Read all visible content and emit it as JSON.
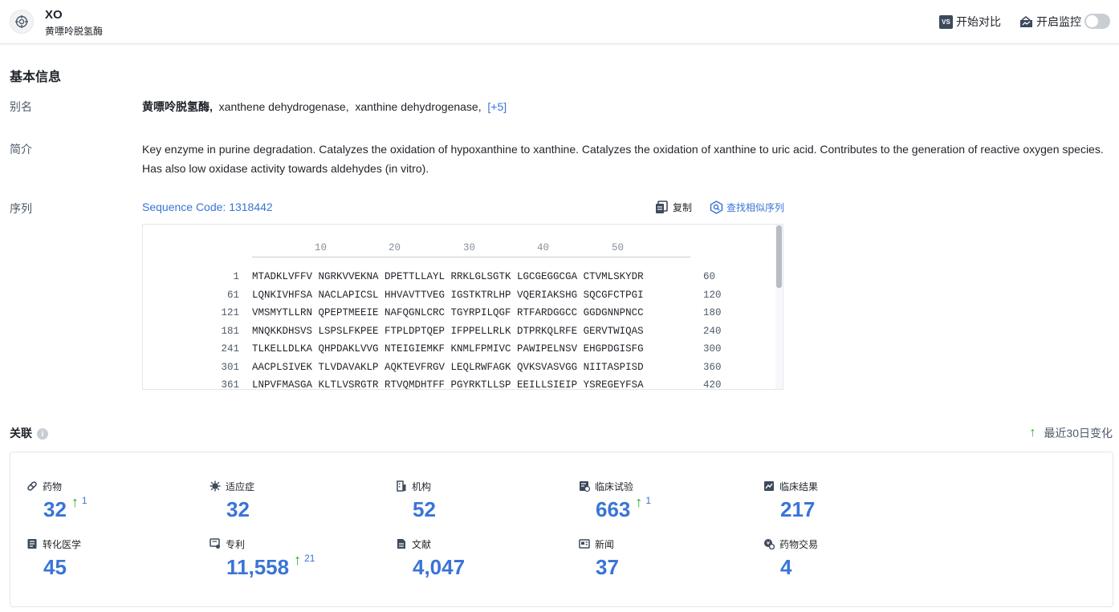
{
  "header": {
    "title": "XO",
    "subtitle": "黄嘌呤脱氢酶",
    "compare_label": "开始对比",
    "compare_badge": "VS",
    "monitor_label": "开启监控",
    "monitor_enabled": false
  },
  "basic_info": {
    "section_title": "基本信息",
    "alias_label": "别名",
    "aliases": [
      "黄嘌呤脱氢酶,",
      "xanthene dehydrogenase,",
      "xanthine dehydrogenase,"
    ],
    "alias_more": "[+5]",
    "intro_label": "简介",
    "intro_text": "Key enzyme in purine degradation. Catalyzes the oxidation of hypoxanthine to xanthine. Catalyzes the oxidation of xanthine to uric acid. Contributes to the generation of reactive oxygen species. Has also low oxidase activity towards aldehydes (in vitro).",
    "sequence_label": "序列",
    "sequence_code": "Sequence Code: 1318442",
    "copy_label": "复制",
    "find_similar_label": "查找相似序列",
    "ruler_ticks": [
      "10",
      "20",
      "30",
      "40",
      "50"
    ],
    "sequence_rows": [
      {
        "start": "1",
        "seq": "MTADKLVFFV NGRKVVEKNA DPETTLLAYL RRKLGLSGTK LGCGEGGCGA CTVMLSKYDR",
        "end": "60"
      },
      {
        "start": "61",
        "seq": "LQNKIVHFSA NACLAPICSL HHVAVTTVEG IGSTKTRLHP VQERIAKSHG SQCGFCTPGI",
        "end": "120"
      },
      {
        "start": "121",
        "seq": "VMSMYTLLRN QPEPTMEEIE NAFQGNLCRC TGYRPILQGF RTFARDGGCC GGDGNNPNCC",
        "end": "180"
      },
      {
        "start": "181",
        "seq": "MNQKKDHSVS LSPSLFKPEE FTPLDPTQEP IFPPELLRLK DTPRKQLRFE GERVTWIQAS",
        "end": "240"
      },
      {
        "start": "241",
        "seq": "TLKELLDLKA QHPDAKLVVG NTEIGIEMKF KNMLFPMIVC PAWIPELNSV EHGPDGISFG",
        "end": "300"
      },
      {
        "start": "301",
        "seq": "AACPLSIVEK TLVDAVAKLP AQKTEVFRGV LEQLRWFAGK QVKSVASVGG NIITASPISD",
        "end": "360"
      },
      {
        "start": "361",
        "seq": "LNPVFMASGA KLTLVSRGTR RTVQMDHTFF PGYRKTLLSP EEILLSIEIP YSREGEYFSA",
        "end": "420"
      }
    ]
  },
  "related": {
    "section_title": "关联",
    "trend_label": "最近30日变化",
    "stats": [
      {
        "label": "药物",
        "value": "32",
        "delta": "1",
        "icon": "pill-icon"
      },
      {
        "label": "适应症",
        "value": "32",
        "delta": "",
        "icon": "virus-icon"
      },
      {
        "label": "机构",
        "value": "52",
        "delta": "",
        "icon": "building-icon"
      },
      {
        "label": "临床试验",
        "value": "663",
        "delta": "1",
        "icon": "clinical-trial-icon"
      },
      {
        "label": "临床结果",
        "value": "217",
        "delta": "",
        "icon": "clinical-result-icon"
      },
      {
        "label": "转化医学",
        "value": "45",
        "delta": "",
        "icon": "translational-icon"
      },
      {
        "label": "专利",
        "value": "11,558",
        "delta": "21",
        "icon": "patent-icon"
      },
      {
        "label": "文献",
        "value": "4,047",
        "delta": "",
        "icon": "document-icon"
      },
      {
        "label": "新闻",
        "value": "37",
        "delta": "",
        "icon": "news-icon"
      },
      {
        "label": "药物交易",
        "value": "4",
        "delta": "",
        "icon": "deal-icon"
      }
    ]
  }
}
